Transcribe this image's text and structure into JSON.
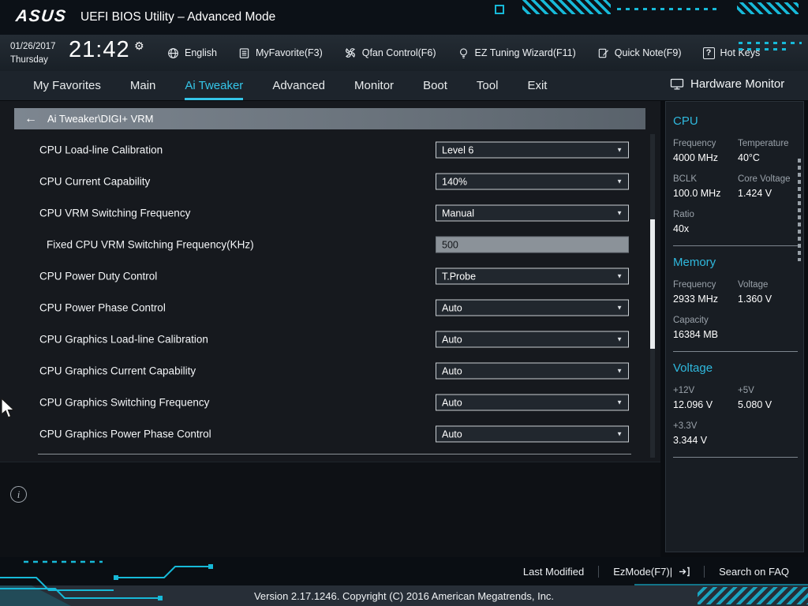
{
  "icons": {
    "back_arrow": "←",
    "gear": "⚙",
    "dropdown_arrow": "▼",
    "info": "i",
    "hotkeys": "?"
  },
  "colors": {
    "accent_cyan": "#35c6e9",
    "circuit_teal": "#17b9d8",
    "section_heading_cyan": "#2fb9de"
  },
  "header": {
    "brand": "ASUS",
    "title": "UEFI BIOS Utility – Advanced Mode"
  },
  "toolbar": {
    "date": "01/26/2017",
    "day": "Thursday",
    "time": "21:42",
    "buttons": [
      {
        "label": "English",
        "icon": "globe-icon"
      },
      {
        "label": "MyFavorite(F3)",
        "icon": "favorite-list-icon"
      },
      {
        "label": "Qfan Control(F6)",
        "icon": "fan-icon"
      },
      {
        "label": "EZ Tuning Wizard(F11)",
        "icon": "wizard-bulb-icon"
      },
      {
        "label": "Quick Note(F9)",
        "icon": "note-pencil-icon"
      },
      {
        "label": "Hot Keys",
        "icon": "question-box-icon"
      }
    ]
  },
  "nav": {
    "tabs": [
      {
        "label": "My Favorites",
        "active": false
      },
      {
        "label": "Main",
        "active": false
      },
      {
        "label": "Ai Tweaker",
        "active": true
      },
      {
        "label": "Advanced",
        "active": false
      },
      {
        "label": "Monitor",
        "active": false
      },
      {
        "label": "Boot",
        "active": false
      },
      {
        "label": "Tool",
        "active": false
      },
      {
        "label": "Exit",
        "active": false
      }
    ]
  },
  "breadcrumb": "Ai Tweaker\\DIGI+ VRM",
  "settings": [
    {
      "label": "CPU Load-line Calibration",
      "value": "Level 6",
      "type": "dropdown"
    },
    {
      "label": "CPU Current Capability",
      "value": "140%",
      "type": "dropdown"
    },
    {
      "label": "CPU VRM Switching Frequency",
      "value": "Manual",
      "type": "dropdown"
    },
    {
      "label": "Fixed CPU VRM Switching Frequency(KHz)",
      "value": "500",
      "type": "input"
    },
    {
      "label": "CPU Power Duty Control",
      "value": "T.Probe",
      "type": "dropdown"
    },
    {
      "label": "CPU Power Phase Control",
      "value": "Auto",
      "type": "dropdown"
    },
    {
      "label": "CPU Graphics Load-line Calibration",
      "value": "Auto",
      "type": "dropdown"
    },
    {
      "label": "CPU Graphics Current Capability",
      "value": "Auto",
      "type": "dropdown"
    },
    {
      "label": "CPU Graphics Switching Frequency",
      "value": "Auto",
      "type": "dropdown"
    },
    {
      "label": "CPU Graphics Power Phase Control",
      "value": "Auto",
      "type": "dropdown"
    }
  ],
  "hardware_monitor": {
    "title": "Hardware Monitor",
    "sections": [
      {
        "title": "CPU",
        "rows": [
          {
            "cells": [
              {
                "label": "Frequency",
                "value": "4000 MHz"
              },
              {
                "label": "Temperature",
                "value": "40°C"
              }
            ]
          },
          {
            "cells": [
              {
                "label": "BCLK",
                "value": "100.0 MHz"
              },
              {
                "label": "Core Voltage",
                "value": "1.424 V"
              }
            ]
          },
          {
            "cells": [
              {
                "label": "Ratio",
                "value": "40x"
              }
            ]
          }
        ]
      },
      {
        "title": "Memory",
        "rows": [
          {
            "cells": [
              {
                "label": "Frequency",
                "value": "2933 MHz"
              },
              {
                "label": "Voltage",
                "value": "1.360 V"
              }
            ]
          },
          {
            "cells": [
              {
                "label": "Capacity",
                "value": "16384 MB"
              }
            ]
          }
        ]
      },
      {
        "title": "Voltage",
        "rows": [
          {
            "cells": [
              {
                "label": "+12V",
                "value": "12.096 V"
              },
              {
                "label": "+5V",
                "value": "5.080 V"
              }
            ]
          },
          {
            "cells": [
              {
                "label": "+3.3V",
                "value": "3.344 V"
              }
            ]
          }
        ]
      }
    ]
  },
  "footer": {
    "last_modified": "Last Modified",
    "ez_mode": "EzMode(F7)|",
    "search_faq": "Search on FAQ",
    "version": "Version 2.17.1246. Copyright (C) 2016 American Megatrends, Inc."
  }
}
